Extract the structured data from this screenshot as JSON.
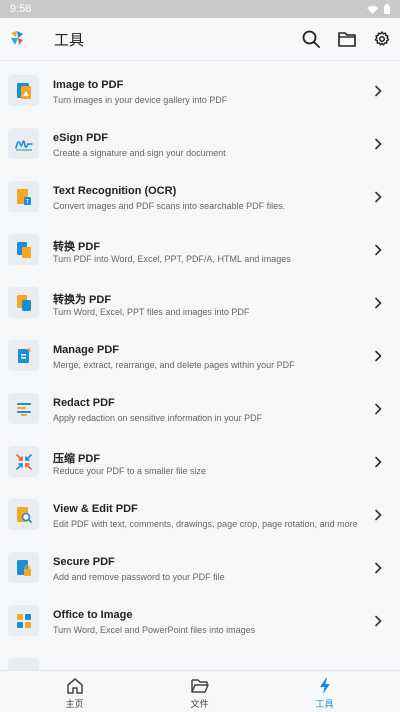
{
  "status_bar": {
    "time": "9:58"
  },
  "app_bar": {
    "title": "工具"
  },
  "tools": [
    {
      "title": "Image to PDF",
      "desc": "Turn images in your device gallery into PDF",
      "icon": "image-to-pdf-icon"
    },
    {
      "title": "eSign PDF",
      "desc": "Create a signature and sign your document",
      "icon": "signature-icon"
    },
    {
      "title": "Text Recognition (OCR)",
      "desc": "Convert images and PDF scans into searchable PDF files.",
      "icon": "ocr-icon"
    },
    {
      "title": "转换 PDF",
      "desc": "Turn PDF into Word, Excel, PPT, PDF/A, HTML and images",
      "icon": "convert-pdf-icon"
    },
    {
      "title": "转换为 PDF",
      "desc": "Turn Word, Excel, PPT files and images into PDF",
      "icon": "convert-to-pdf-icon"
    },
    {
      "title": "Manage PDF",
      "desc": "Merge, extract, rearrange, and delete pages within your PDF",
      "icon": "manage-pdf-icon"
    },
    {
      "title": "Redact PDF",
      "desc": "Apply redaction on sensitive information in your PDF",
      "icon": "redact-icon"
    },
    {
      "title": "压缩 PDF",
      "desc": "Reduce your PDF to a smaller file size",
      "icon": "compress-icon"
    },
    {
      "title": "View & Edit PDF",
      "desc": "Edit PDF with text, comments, drawings, page crop, page rotation, and more",
      "icon": "view-edit-icon"
    },
    {
      "title": "Secure PDF",
      "desc": "Add and remove password to your PDF file",
      "icon": "secure-pdf-icon"
    },
    {
      "title": "Office to Image",
      "desc": "Turn Word, Excel and PowerPoint files into images",
      "icon": "office-to-image-icon"
    }
  ],
  "bottom_nav": {
    "home": "主页",
    "files": "文件",
    "tools": "工具"
  },
  "colors": {
    "accent": "#1a8fd6",
    "orange": "#f5a623"
  }
}
